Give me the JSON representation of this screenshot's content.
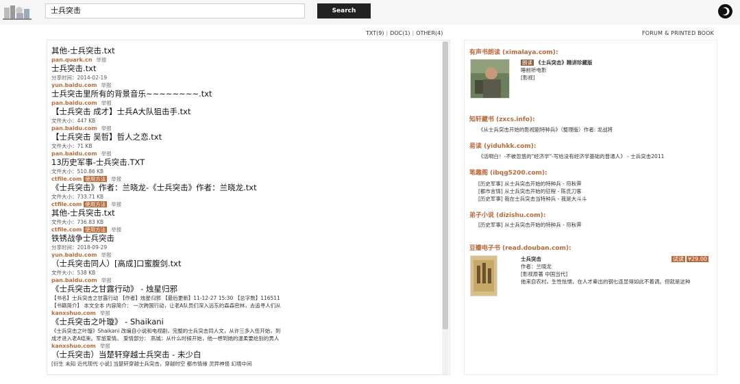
{
  "search": {
    "value": "士兵突击",
    "button_label": "Search"
  },
  "filters": {
    "txt": "TXT(9)",
    "doc": "DOC(1)",
    "other": "OTHER(4)"
  },
  "right_header": "FORUM & PRINTED BOOK",
  "results": [
    {
      "title": "其他-士兵突击.txt",
      "meta": "",
      "domain": "pan.quark.cn",
      "tag": "",
      "report": "举报"
    },
    {
      "title": "士兵突击.txt",
      "meta": "分享时间：2014-02-19",
      "domain": "yun.baidu.com",
      "tag": "",
      "report": "举报"
    },
    {
      "title": "士兵突击里所有的背景音乐~~~~~~~~.txt",
      "meta": "",
      "domain": "pan.baidu.com",
      "tag": "",
      "report": "举报"
    },
    {
      "title": "【士兵突击 成才】士兵A大队狙击手.txt",
      "meta": "文件大小：447 KB",
      "domain": "pan.baidu.com",
      "tag": "",
      "report": "举报"
    },
    {
      "title": "【士兵突击 吴哲】哲人之恋.txt",
      "meta": "文件大小：71 KB",
      "domain": "pan.baidu.com",
      "tag": "",
      "report": "举报"
    },
    {
      "title": "13历史军事-士兵突击.TXT",
      "meta": "文件大小：510.86 KB",
      "domain": "ctfile.com",
      "tag": "使用方法",
      "report": "举报"
    },
    {
      "title": "《士兵突击》作者：兰晓龙-《士兵突击》作者：兰晓龙.txt",
      "meta": "文件大小：733.71 KB",
      "domain": "ctfile.com",
      "tag": "使用方法",
      "report": "举报"
    },
    {
      "title": "其他-士兵突击.txt",
      "meta": "文件大小：736.83 KB",
      "domain": "ctfile.com",
      "tag": "使用方法",
      "report": "举报"
    },
    {
      "title": "铁锈战争士兵突击",
      "meta": "分享时间：2018-09-29",
      "domain": "yun.baidu.com",
      "tag": "",
      "report": "举报"
    },
    {
      "title": "（士兵突击同人）[高成]口蜜腹剑.txt",
      "meta": "文件大小：538 KB",
      "domain": "pan.baidu.com",
      "tag": "",
      "report": "举报"
    }
  ],
  "novels": [
    {
      "title": "《士兵突击之甘露行动》 - 烛星归邪",
      "desc1": "【书名】士兵突击之甘露行动 【作者】烛星归邪 【最后更新】11-12-27 15:30 【总字数】116511",
      "desc2": "【书籍简介】 本文全本 内容简介： 一次跨国行动，让老A队员们深入远东的森森密林，去追寻人们从",
      "domain": "kanxshuo.com",
      "report": "举报"
    },
    {
      "title": "《士兵突击之叶璇》 - Shaikani",
      "desc1": "《士兵突击之叶璇》Shaikani 改编自小说和电视剧，完整的士兵突击同人文，从许三多入伍开始，到",
      "desc2": "成才进入老A结束。军旅爱情。 爱情部分： 高城：从什么时候开始，他一想到她的温柔要给别的男人",
      "domain": "kanxshuo.com",
      "report": "举报"
    },
    {
      "title": "（士兵突击）当楚轩穿越士兵突击 - 未少白",
      "desc1": "[衍生 未知 近代现代 小说] 当楚轩穿越士兵突击，穿越时空 都市情缘 灵异神怪 幻境中间",
      "desc2": "",
      "domain": "",
      "report": ""
    }
  ],
  "audio": {
    "section_title": "有声书朗读 (ximalaya.com):",
    "badge": "朗读",
    "title": "《士兵突击》精讲珍藏版",
    "line2": "睡前听电影",
    "line3": "[影视]"
  },
  "zxcs": {
    "section_title": "知轩藏书 (zxcs.info):",
    "line": "《从士兵突击开始的影视剧特种兵》（整理版）作者: 龙战将"
  },
  "yiduhkk": {
    "section_title": "易读 (yiduhkk.com):",
    "line": "《活明白！-不被忽悠的\"经济学\"-写给没有经济学基础的普通人》 - 士兵突击2011"
  },
  "ibqg": {
    "section_title": "笔趣阁 (ibqg5200.com):",
    "lines": [
      "[历史军事] 从士兵突击开始的特种兵 - 帘秋霁",
      "[都市言情] 从士兵突击开始的征程 - 陈氏刀客",
      "[历史军事] 我在士兵突击当特种兵 - 我是大斗斗"
    ]
  },
  "dizishu": {
    "section_title": "弟子小说 (dizishu.com):",
    "line": "[历史军事] 从士兵突击开始的特种兵 - 帘秋霁"
  },
  "douban": {
    "section_title": "豆瓣电子书 (read.douban.com):",
    "title": "士兵突击",
    "author": "作者：兰晓龙",
    "category": "[影视原著 中国当代]",
    "desc": "他来自农村，生性怯懦，在人才辈出的钢七连显得如此不着调。但就是这种",
    "try_label": "试读",
    "price": "¥29.00"
  }
}
